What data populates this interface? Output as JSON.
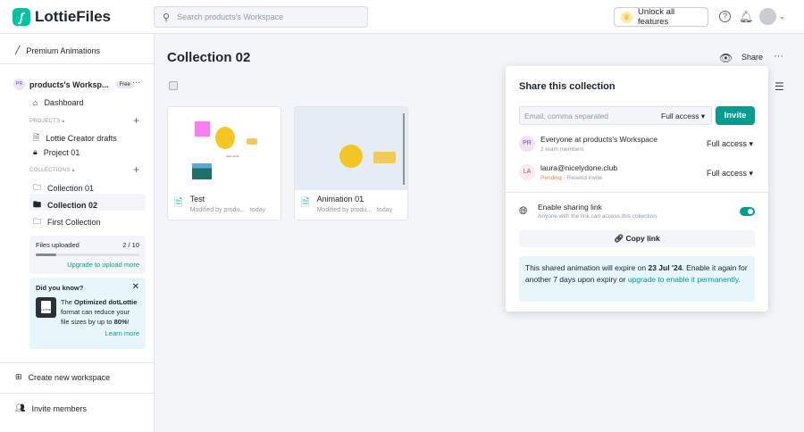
{
  "header": {
    "logo": "LottieFiles",
    "search_placeholder": "Search products's Workspace",
    "unlock": "Unlock all features"
  },
  "sidebar": {
    "premium": "Premium Animations",
    "workspace": {
      "initials": "PR",
      "name": "products's Worksp...",
      "badge": "Free"
    },
    "dashboard": "Dashboard",
    "projects_label": "PROJECTS",
    "projects": [
      "Lottie Creator drafts",
      "Project 01"
    ],
    "collections_label": "COLLECTIONS",
    "collections": [
      "Collection 01",
      "Collection 02",
      "First Collection"
    ],
    "files": {
      "label": "Files uploaded",
      "count": "2 / 10",
      "progress": 0.2,
      "upgrade": "Upgrade to upload more"
    },
    "tip": {
      "title": "Did you know?",
      "pre": "The ",
      "bold": "Optimized dotLottie",
      "mid": " format can reduce your file sizes by up to ",
      "pct": "80%",
      "end": "!",
      "link": "Learn more",
      "file_label": "LOTTIE"
    },
    "create": "Create new workspace",
    "invite": "Invite members"
  },
  "main": {
    "title": "Collection 02",
    "share": "Share",
    "cards": [
      {
        "title": "Test",
        "sub": "Modified by produ...",
        "time": "today",
        "caption": "hello world"
      },
      {
        "title": "Animation 01",
        "sub": "Modified by produ...",
        "time": "today"
      }
    ]
  },
  "share": {
    "title": "Share this collection",
    "email_placeholder": "Email, comma separated",
    "access": "Full access",
    "invite": "Invite",
    "members": [
      {
        "initials": "PR",
        "name": "Everyone at products's Workspace",
        "sub": "2 team members",
        "access": "Full access"
      },
      {
        "initials": "LA",
        "name": "laura@nicelydone.club",
        "pending": "Pending",
        "resend": " · Resend invite",
        "access": "Full access"
      }
    ],
    "link_title": "Enable sharing link",
    "link_sub": "Anyone with the link can access this collection",
    "link_enabled": true,
    "copy": "Copy link",
    "notice": {
      "pre": "This shared animation will expire on ",
      "date": "23 Jul '24",
      "mid": ". Enable it again for another 7 days upon expiry or ",
      "link": "upgrade to enable it permanently."
    }
  }
}
